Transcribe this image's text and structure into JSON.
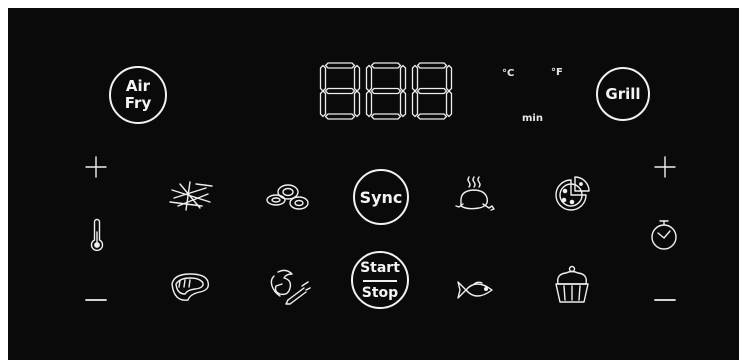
{
  "panel": {
    "air_fry": {
      "line1": "Air",
      "line2": "Fry"
    },
    "grill": "Grill",
    "display": {
      "digits": "888"
    },
    "units": {
      "celsius": "°C",
      "fahrenheit": "°F",
      "minutes": "min"
    },
    "sync": "Sync",
    "start_stop": {
      "start": "Start",
      "stop": "Stop"
    },
    "left_controls": {
      "plus": "+",
      "minus": "—",
      "icon": "thermometer-icon"
    },
    "right_controls": {
      "plus": "+",
      "minus": "—",
      "icon": "timer-icon"
    },
    "presets": [
      "fries-icon",
      "vegetables-icon",
      "chicken-icon",
      "pizza-icon",
      "steak-icon",
      "shrimp-icon",
      "fish-icon",
      "dessert-icon"
    ]
  },
  "colors": {
    "background": "#0a0a0a",
    "foreground": "#f0f0f0"
  }
}
